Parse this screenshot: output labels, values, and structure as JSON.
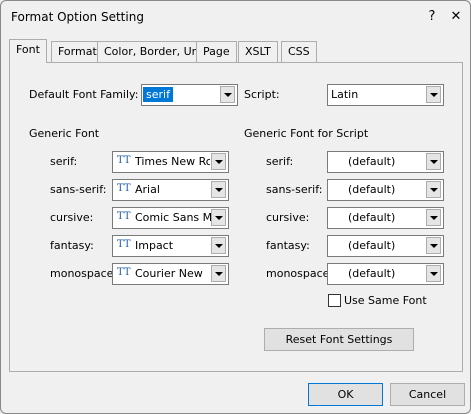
{
  "window": {
    "title": "Format Option Setting",
    "help": "?",
    "close": "✕"
  },
  "tabs": [
    "Font",
    "Format",
    "Color, Border, Unit",
    "Page",
    "XSLT",
    "CSS"
  ],
  "font_tab": {
    "default_family_label": "Default Font Family:",
    "default_family_value": "serif",
    "script_label": "Script:",
    "script_value": "Latin",
    "generic_heading": "Generic Font",
    "script_heading": "Generic Font for Script",
    "generic": [
      {
        "label": "serif:",
        "value": "Times New Rom"
      },
      {
        "label": "sans-serif:",
        "value": "Arial"
      },
      {
        "label": "cursive:",
        "value": "Comic Sans MS"
      },
      {
        "label": "fantasy:",
        "value": "Impact"
      },
      {
        "label": "monospace:",
        "value": "Courier New"
      }
    ],
    "script_fonts": [
      {
        "label": "serif:",
        "value": "(default)"
      },
      {
        "label": "sans-serif:",
        "value": "(default)"
      },
      {
        "label": "cursive:",
        "value": "(default)"
      },
      {
        "label": "fantasy:",
        "value": "(default)"
      },
      {
        "label": "monospace:",
        "value": "(default)"
      }
    ],
    "use_same_font": "Use Same Font",
    "reset_button": "Reset Font Settings"
  },
  "buttons": {
    "ok": "OK",
    "cancel": "Cancel"
  },
  "icons": {
    "truetype": "TrueType font icon"
  }
}
